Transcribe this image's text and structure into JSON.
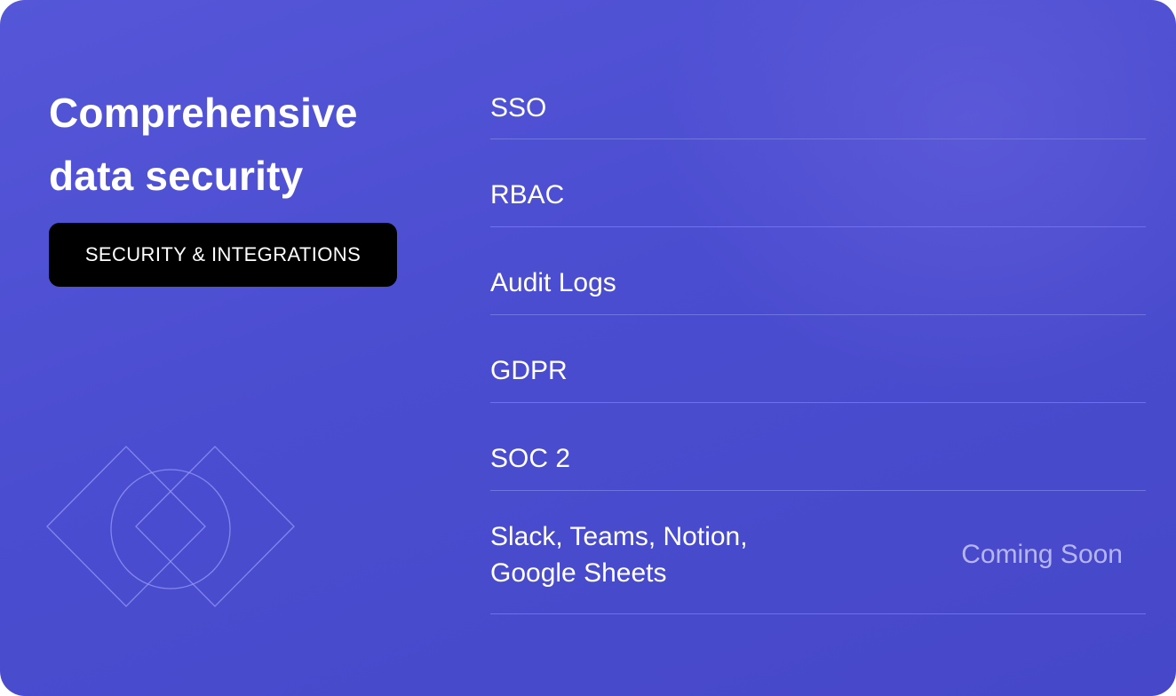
{
  "header": {
    "title": "Comprehensive data security",
    "badge": "SECURITY & INTEGRATIONS"
  },
  "features": [
    {
      "label": "SSO",
      "status": ""
    },
    {
      "label": "RBAC",
      "status": ""
    },
    {
      "label": "Audit Logs",
      "status": ""
    },
    {
      "label": "GDPR",
      "status": ""
    },
    {
      "label": "SOC 2",
      "status": ""
    },
    {
      "label": "Slack, Teams, Notion, Google Sheets",
      "status": "Coming Soon"
    }
  ],
  "colors": {
    "background": "#4b4dd0",
    "badge_background": "#000000",
    "text": "#ffffff",
    "muted_text": "#cdcdfa",
    "divider": "#8c96f0"
  },
  "decoration": {
    "icon": "diamond-circle-outline-icon"
  }
}
